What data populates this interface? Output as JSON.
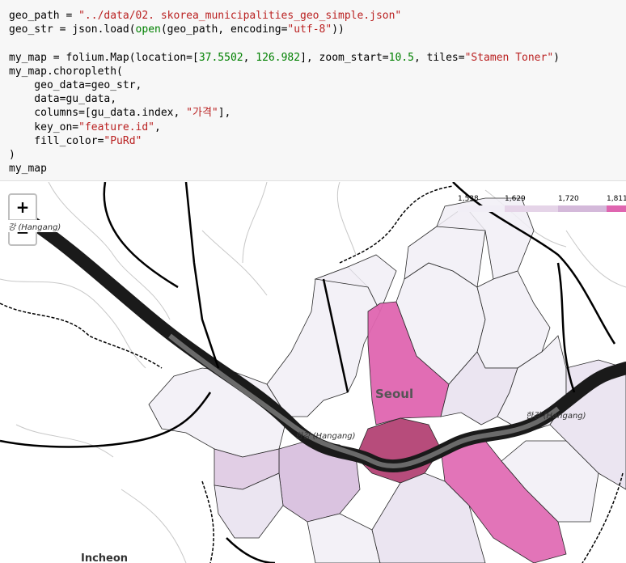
{
  "code": {
    "line1": {
      "a": "geo_path = ",
      "b": "\"../data/02. skorea_municipalities_geo_simple.json\""
    },
    "line2": {
      "a": "geo_str = json.load(",
      "b": "open",
      "c": "(geo_path, encoding=",
      "d": "\"utf-8\"",
      "e": "))"
    },
    "line3": {
      "a": "my_map = folium.Map(location=[",
      "b": "37.5502",
      "c": ", ",
      "d": "126.982",
      "e": "], zoom_start=",
      "f": "10.5",
      "g": ", tiles=",
      "h": "\"Stamen Toner\"",
      "i": ")"
    },
    "line4": "my_map.choropleth(",
    "line5": "    geo_data=geo_str,",
    "line6": "    data=gu_data,",
    "line7": {
      "a": "    columns=[gu_data.index, ",
      "b": "\"가격\"",
      "c": "],"
    },
    "line8": {
      "a": "    key_on=",
      "b": "\"feature.id\"",
      "c": ","
    },
    "line9": {
      "a": "    fill_color=",
      "b": "\"PuRd\""
    },
    "line10": ")",
    "line11": "my_map"
  },
  "map": {
    "zoom_in": "+",
    "zoom_out": "−",
    "legend": {
      "ticks": [
        "1,538",
        "1,629",
        "1,720",
        "1,811"
      ],
      "colors": [
        "#f1eef6",
        "#e5d4e8",
        "#d4b9da",
        "#df65b0"
      ]
    },
    "labels": {
      "seoul": "Seoul",
      "hangang_center": "한강 (Hangang)",
      "hangang_east": "한강 (Hangang)",
      "hangang_west": "강 (Hangang)",
      "incheon": "Incheon"
    },
    "choropleth_colors": {
      "light": "#f1eef6",
      "light2": "#e7e1ef",
      "mid": "#d4b9da",
      "pink": "#df65b0",
      "dark": "#980043"
    }
  }
}
